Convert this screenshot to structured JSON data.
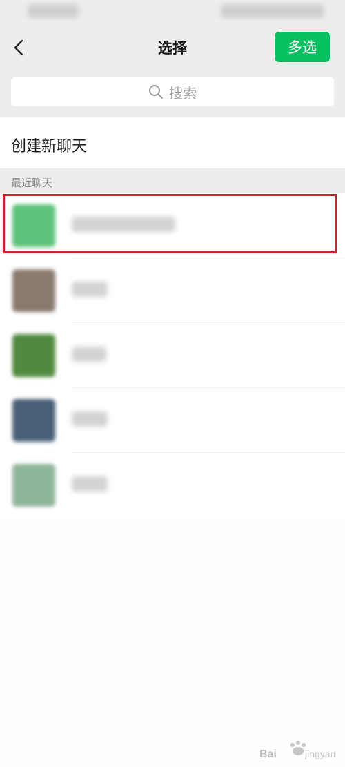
{
  "header": {
    "title": "选择",
    "multi_select_label": "多选"
  },
  "search": {
    "placeholder": "搜索"
  },
  "create_chat": {
    "label": "创建新聊天"
  },
  "recent": {
    "section_label": "最近聊天",
    "items": [
      {
        "avatar_color": "#5ec37a",
        "highlighted": true
      },
      {
        "avatar_color": "#8a7a6e",
        "highlighted": false
      },
      {
        "avatar_color": "#4f8a3e",
        "highlighted": false
      },
      {
        "avatar_color": "#4a5f78",
        "highlighted": false
      },
      {
        "avatar_color": "#8fb59b",
        "highlighted": false
      }
    ]
  },
  "colors": {
    "accent": "#07c160",
    "highlight_border": "#c9222a",
    "header_bg": "#ededed"
  },
  "icons": {
    "back": "chevron-left-icon",
    "search": "search-icon",
    "watermark": "baidu-jingyan-logo"
  }
}
